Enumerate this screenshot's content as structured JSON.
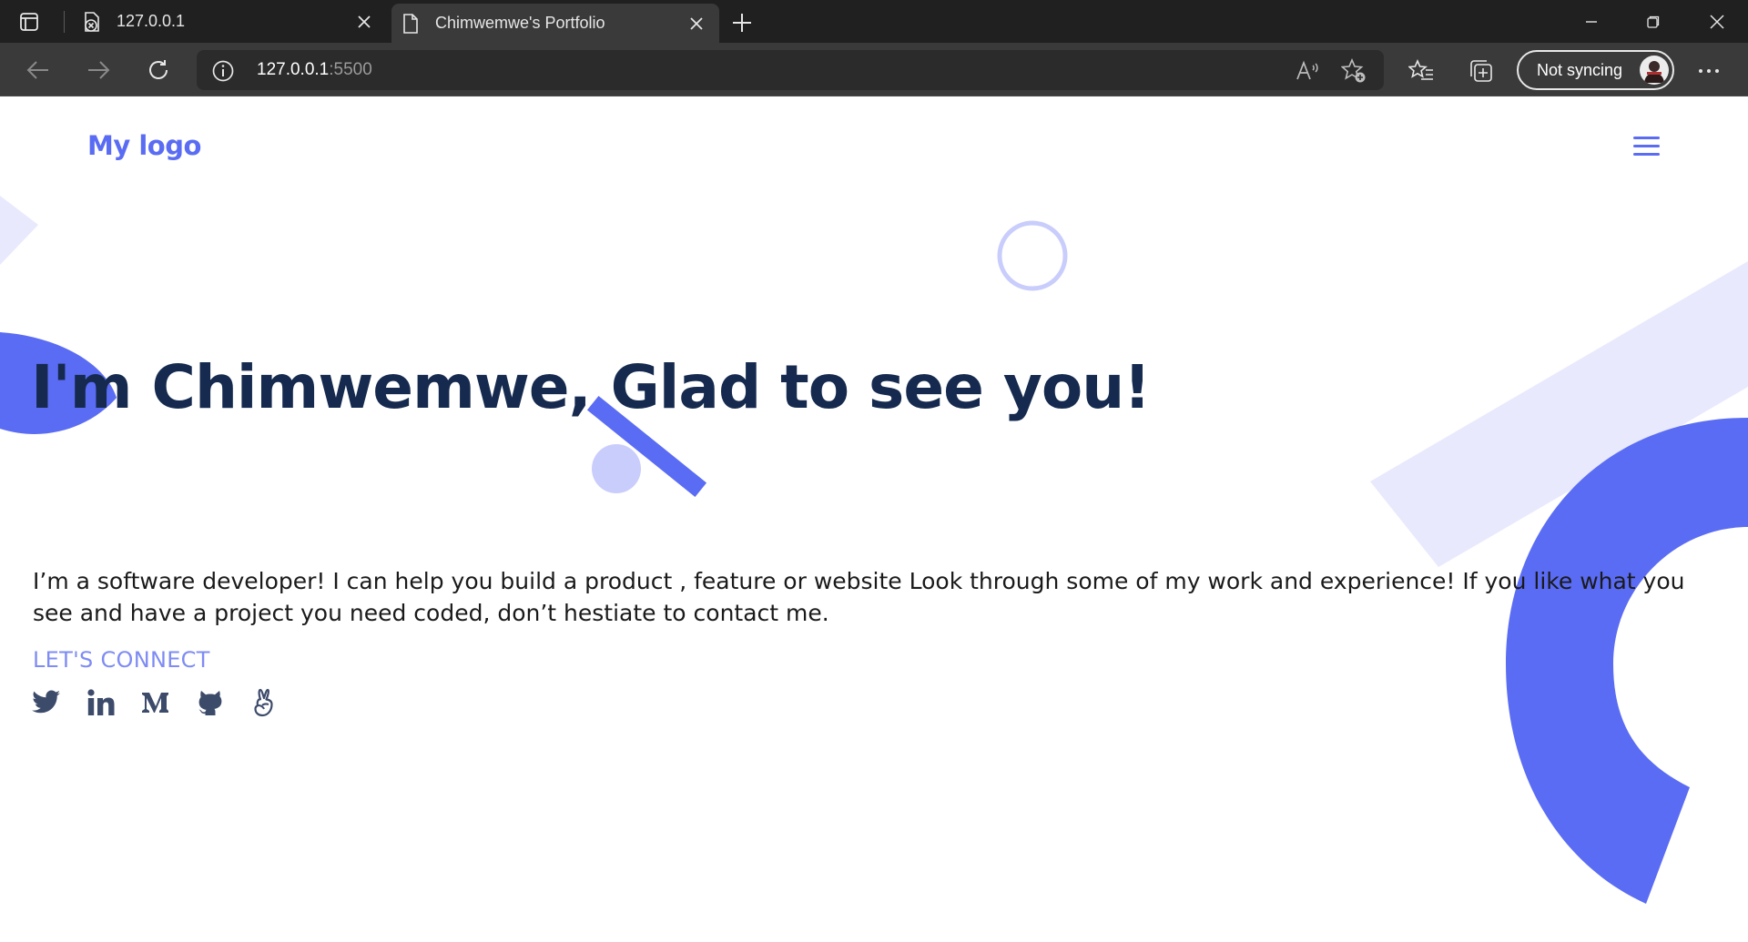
{
  "browser": {
    "tabs": [
      {
        "title": "127.0.0.1",
        "active": false,
        "favicon": "page-error-icon"
      },
      {
        "title": "Chimwemwe's Portfolio",
        "active": true,
        "favicon": "page-icon"
      }
    ],
    "address": {
      "host": "127.0.0.1",
      "port": ":5500"
    },
    "profile_label": "Not syncing"
  },
  "nav": {
    "logo": "My logo"
  },
  "hero": {
    "headline": "I'm Chimwemwe, Glad to see you!",
    "intro": "I’m a software developer! I can help you build a product , feature or website Look through some of my work and experience! If you like what you see and have a project you need coded, don’t hestiate to contact me.",
    "cta": "LET'S CONNECT",
    "socials": [
      {
        "name": "twitter",
        "icon": "twitter-icon"
      },
      {
        "name": "linkedin",
        "icon": "linkedin-icon"
      },
      {
        "name": "medium",
        "icon": "medium-icon"
      },
      {
        "name": "github",
        "icon": "github-icon"
      },
      {
        "name": "angellist",
        "icon": "angellist-icon"
      }
    ]
  },
  "colors": {
    "accent": "#5a6cf3",
    "heading": "#152a4e",
    "cta": "#7e8cf4",
    "social_icons": "#3d4b6b",
    "deco_light": "#e8e9fd",
    "deco_mid": "#c9cdfb"
  }
}
